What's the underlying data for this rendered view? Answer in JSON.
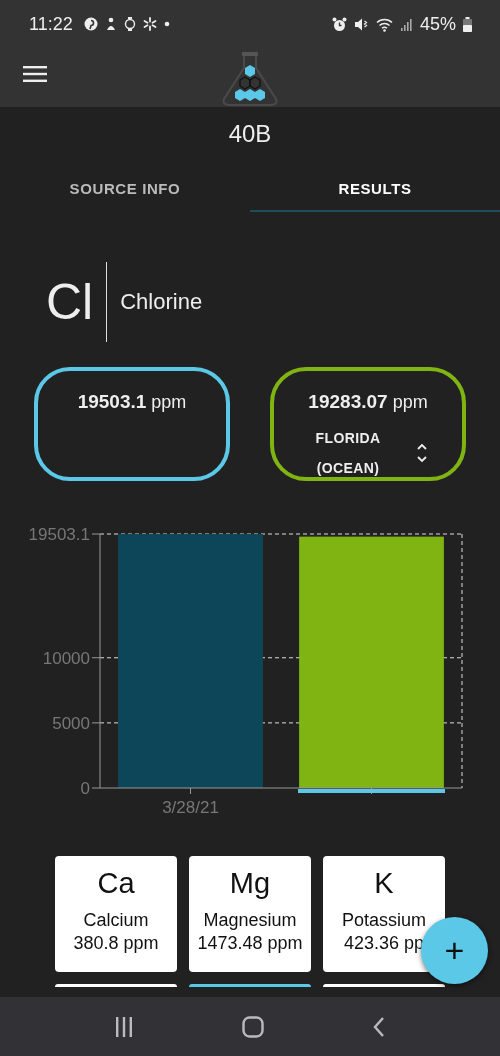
{
  "status_bar": {
    "time": "11:22",
    "battery": "45%"
  },
  "title": "40B",
  "tabs": [
    {
      "label": "SOURCE INFO",
      "selected": false
    },
    {
      "label": "RESULTS",
      "selected": true
    }
  ],
  "element": {
    "symbol": "Cl",
    "name": "Chlorine"
  },
  "readings": [
    {
      "value": "19503.1",
      "unit": "ppm",
      "color": "#5bc8e8"
    },
    {
      "value": "19283.07",
      "unit": "ppm",
      "color": "#80b413",
      "source": "FLORIDA (OCEAN)"
    }
  ],
  "chart_data": {
    "type": "bar",
    "categories": [
      "3/28/21",
      null
    ],
    "series": [
      {
        "color": "#0e4659",
        "values": [
          19500,
          null
        ]
      },
      {
        "color": "#80b413",
        "values": [
          null,
          19300
        ]
      }
    ],
    "ylim": [
      0,
      19503.1
    ],
    "yticks": [
      0,
      5000,
      10000,
      {
        "value": 19503.1,
        "label": "19503.1"
      }
    ]
  },
  "tiles": [
    {
      "symbol": "Ca",
      "name": "Calcium",
      "amount": "380.8 ppm",
      "selected": false
    },
    {
      "symbol": "Mg",
      "name": "Magnesium",
      "amount": "1473.48 ppm",
      "selected": false
    },
    {
      "symbol": "K",
      "name": "Potassium",
      "amount": "423.36 pp",
      "selected": false
    }
  ],
  "lower_tiles": [
    {
      "selected": false
    },
    {
      "selected": true
    },
    {
      "selected": false
    }
  ],
  "fab": "+"
}
